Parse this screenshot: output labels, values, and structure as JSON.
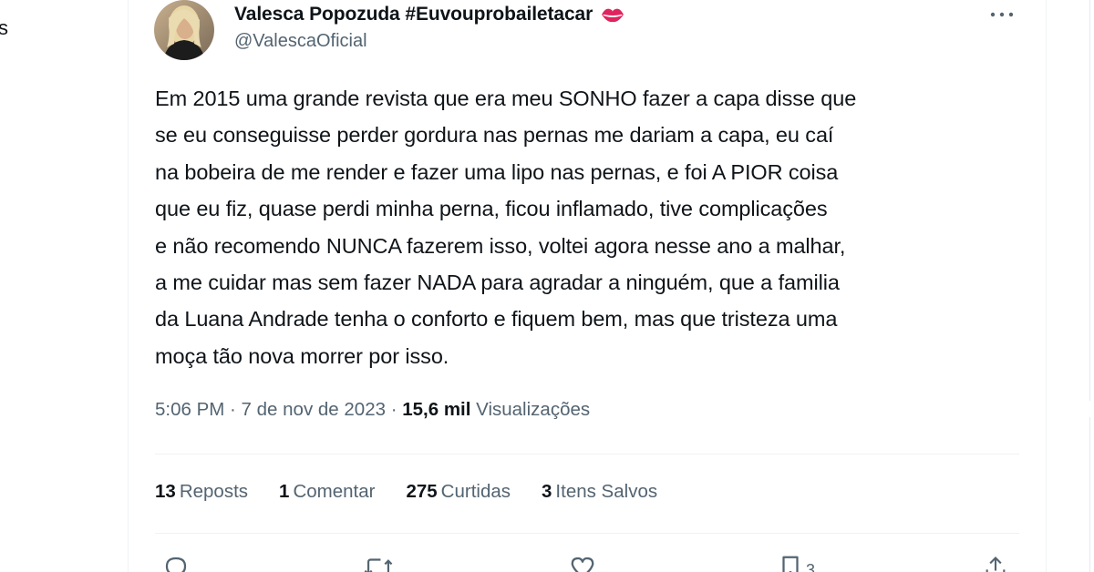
{
  "left_sidebar": {
    "partial_text": "s"
  },
  "tweet": {
    "author": {
      "display_name": "Valesca Popozuda #Euvouprobailetacar",
      "name_emoji_icon": "kiss-lips-icon",
      "handle": "@ValescaOficial"
    },
    "more_icon": "more-horizontal-icon",
    "text": "Em 2015 uma grande revista que era meu SONHO fazer a capa disse que\nse eu conseguisse perder gordura nas pernas me dariam a capa, eu caí\nna bobeira de me render e fazer uma lipo nas pernas, e foi A PIOR coisa\nque eu fiz, quase perdi minha perna, ficou inflamado, tive complicações\ne não recomendo NUNCA fazerem isso, voltei agora nesse ano a malhar,\na me cuidar mas sem fazer NADA para agradar a ninguém, que a familia\nda Luana Andrade tenha o conforto e fiquem bem, mas que tristeza uma\nmoça tão nova morrer por isso.",
    "timestamp": "5:06 PM · 7 de nov de 2023 · ",
    "views_count": "15,6 mil",
    "views_label": " Visualizações",
    "stats": {
      "reposts": {
        "count": "13",
        "label": "Reposts"
      },
      "comments": {
        "count": "1",
        "label": "Comentar"
      },
      "likes": {
        "count": "275",
        "label": "Curtidas"
      },
      "bookmarks": {
        "count": "3",
        "label": "Itens Salvos"
      }
    },
    "actions": {
      "reply_icon": "reply-icon",
      "repost_icon": "repost-icon",
      "like_icon": "heart-icon",
      "bookmark_icon": "bookmark-icon",
      "bookmark_count": "3",
      "share_icon": "share-icon"
    }
  },
  "colors": {
    "text_primary": "#0f1419",
    "text_secondary": "#536471",
    "divider": "#eff3f4",
    "emoji_red": "#e0245e"
  }
}
